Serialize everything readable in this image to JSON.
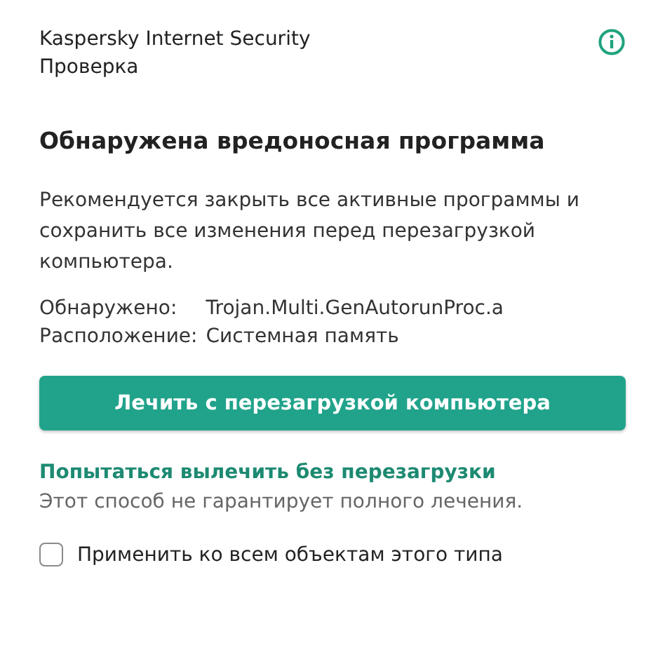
{
  "header": {
    "app": "Kaspersky Internet Security",
    "section": "Проверка"
  },
  "heading": "Обнаружена вредоносная программа",
  "message": "Рекомендуется закрыть все активные программы и сохранить все изменения перед перезагрузкой компьютера.",
  "details": [
    {
      "label": "Обнаружено:",
      "value": "Trojan.Multi.GenAutorunProc.a"
    },
    {
      "label": "Расположение:",
      "value": "Системная память"
    }
  ],
  "primary_button": "Лечить с перезагрузкой компьютера",
  "alt_link": "Попытаться вылечить без перезагрузки",
  "alt_note": "Этот способ не гарантирует полного лечения.",
  "apply_all": {
    "label": "Применить ко всем объектам этого типа",
    "checked": false
  }
}
